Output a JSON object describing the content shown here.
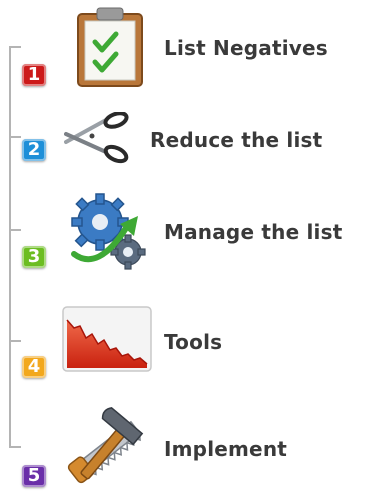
{
  "steps": [
    {
      "number": "1",
      "label": "List Negatives",
      "color": "#cc1a1a",
      "icon": "clipboard-checklist-icon"
    },
    {
      "number": "2",
      "label": "Reduce the list",
      "color": "#1e8fd8",
      "icon": "scissors-icon"
    },
    {
      "number": "3",
      "label": "Manage the list",
      "color": "#6cbd22",
      "icon": "gears-icon"
    },
    {
      "number": "4",
      "label": "Tools",
      "color": "#f2a81e",
      "icon": "declining-chart-icon"
    },
    {
      "number": "5",
      "label": "Implement",
      "color": "#6a2fa8",
      "icon": "hammer-saw-icon"
    }
  ]
}
